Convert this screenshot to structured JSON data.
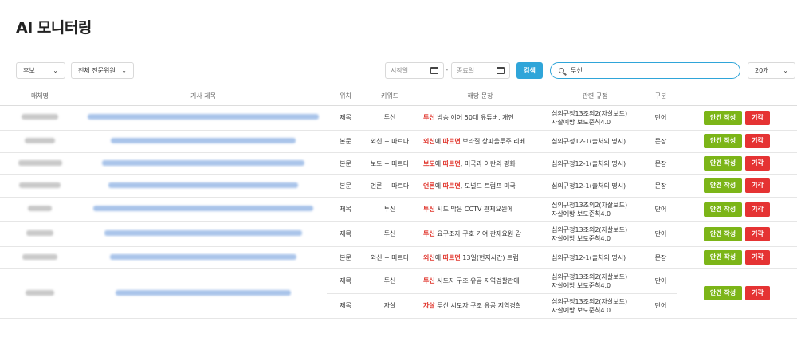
{
  "page_title": "AI 모니터링",
  "filters": {
    "status_value": "후보",
    "committee_value": "전체 전문위원",
    "start_date_placeholder": "시작일",
    "end_date_placeholder": "종료일",
    "date_separator": "-",
    "search_button": "검색",
    "search_value": "투신",
    "page_size_value": "20개"
  },
  "columns": {
    "media": "매체명",
    "title": "기사 제목",
    "position": "위치",
    "keyword": "키워드",
    "sentence": "해당 문장",
    "rule": "관련 규정",
    "type": "구분"
  },
  "actions": {
    "create_label": "안건 작성",
    "reject_label": "기각"
  },
  "colors": {
    "accent_blue": "#2fa5d9",
    "create_green": "#7cb518",
    "reject_red": "#e53333",
    "highlight_red": "#e0342b"
  },
  "rows": [
    {
      "media_w": 46,
      "title_w": 290,
      "position": "제목",
      "keyword": "투신",
      "s_hl1": "투신",
      "s_mid": "",
      "s_hl2": "",
      "s_rest": " 방송 이어 50대 유튜버, 개인",
      "rule1": "심의규정13조의2(자살보도)",
      "rule2": "자살예방 보도준칙4.0",
      "type": "단어"
    },
    {
      "media_w": 38,
      "title_w": 232,
      "position": "본문",
      "keyword": "외신 + 따르다",
      "s_hl1": "외신",
      "s_mid": "에 ",
      "s_hl2": "따르면",
      "s_rest": " 브라질 상파울루주 리베",
      "rule1": "심의규정12-1(출처의 명시)",
      "rule2": "",
      "type": "문장"
    },
    {
      "media_w": 55,
      "title_w": 254,
      "position": "본문",
      "keyword": "보도 + 따르다",
      "s_hl1": "보도",
      "s_mid": "에 ",
      "s_hl2": "따르면",
      "s_rest": ", 미국과 이란의 평화",
      "rule1": "심의규정12-1(출처의 명시)",
      "rule2": "",
      "type": "문장"
    },
    {
      "media_w": 52,
      "title_w": 238,
      "position": "본문",
      "keyword": "언론 + 따르다",
      "s_hl1": "언론",
      "s_mid": "에 ",
      "s_hl2": "따르면",
      "s_rest": ", 도널드 트럼프 미국",
      "rule1": "심의규정12-1(출처의 명시)",
      "rule2": "",
      "type": "문장"
    },
    {
      "media_w": 30,
      "title_w": 276,
      "position": "제목",
      "keyword": "투신",
      "s_hl1": "투신",
      "s_mid": "",
      "s_hl2": "",
      "s_rest": " 시도 막은 CCTV 관제요원에",
      "rule1": "심의규정13조의2(자살보도)",
      "rule2": "자살예방 보도준칙4.0",
      "type": "단어"
    },
    {
      "media_w": 34,
      "title_w": 248,
      "position": "제목",
      "keyword": "투신",
      "s_hl1": "투신",
      "s_mid": "",
      "s_hl2": "",
      "s_rest": " 요구조자 구호 기여 관제요원 감",
      "rule1": "심의규정13조의2(자살보도)",
      "rule2": "자살예방 보도준칙4.0",
      "type": "단어"
    },
    {
      "media_w": 44,
      "title_w": 234,
      "position": "본문",
      "keyword": "외신 + 따르다",
      "s_hl1": "외신",
      "s_mid": "에 ",
      "s_hl2": "따르면",
      "s_rest": " 13일(현지시간) 트럼",
      "rule1": "심의규정12-1(출처의 명시)",
      "rule2": "",
      "type": "문장"
    }
  ],
  "group_row": {
    "media_w": 36,
    "title_w": 220,
    "sub": [
      {
        "position": "제목",
        "keyword": "투신",
        "s_hl1": "투신",
        "s_rest": " 시도자 구조 유공 지역경찰관에",
        "rule1": "심의규정13조의2(자살보도)",
        "rule2": "자살예방 보도준칙4.0",
        "type": "단어"
      },
      {
        "position": "제목",
        "keyword": "자살",
        "s_hl1": "자살",
        "s_rest": " 투신 시도자 구조 유공 지역경찰",
        "rule1": "심의규정13조의2(자살보도)",
        "rule2": "자살예방 보도준칙4.0",
        "type": "단어"
      }
    ]
  }
}
